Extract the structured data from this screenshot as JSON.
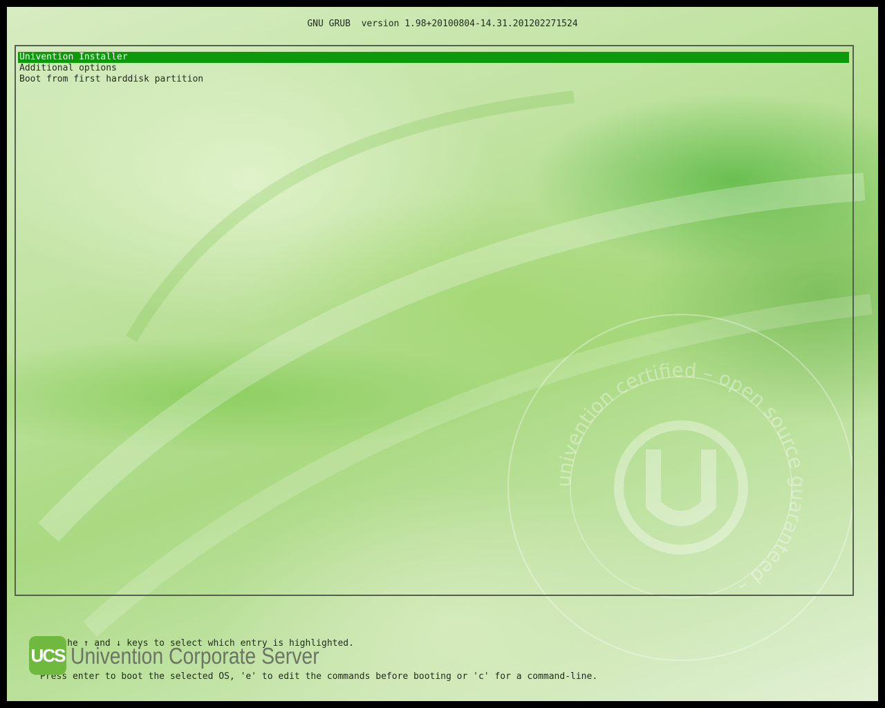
{
  "header": {
    "title": "GNU GRUB  version 1.98+20100804-14.31.201202271524"
  },
  "menu": {
    "selected_index": 0,
    "items": [
      {
        "label": "Univention Installer"
      },
      {
        "label": "Additional options"
      },
      {
        "label": "Boot from first harddisk partition"
      }
    ]
  },
  "help": {
    "line1": "Use the ↑ and ↓ keys to select which entry is highlighted.",
    "line2": "Press enter to boot the selected OS, 'e' to edit the commands before booting or 'c' for a command-line."
  },
  "branding": {
    "badge": "UCS",
    "product_name": "Univention Corporate Server",
    "seal_text": "univention certified – open source guaranteed –"
  },
  "colors": {
    "selection_bg": "#0c9a0c",
    "selection_fg": "#ffffff",
    "text": "#1f2b1c",
    "border": "#54604f",
    "logo_green": "#6fba3e"
  }
}
